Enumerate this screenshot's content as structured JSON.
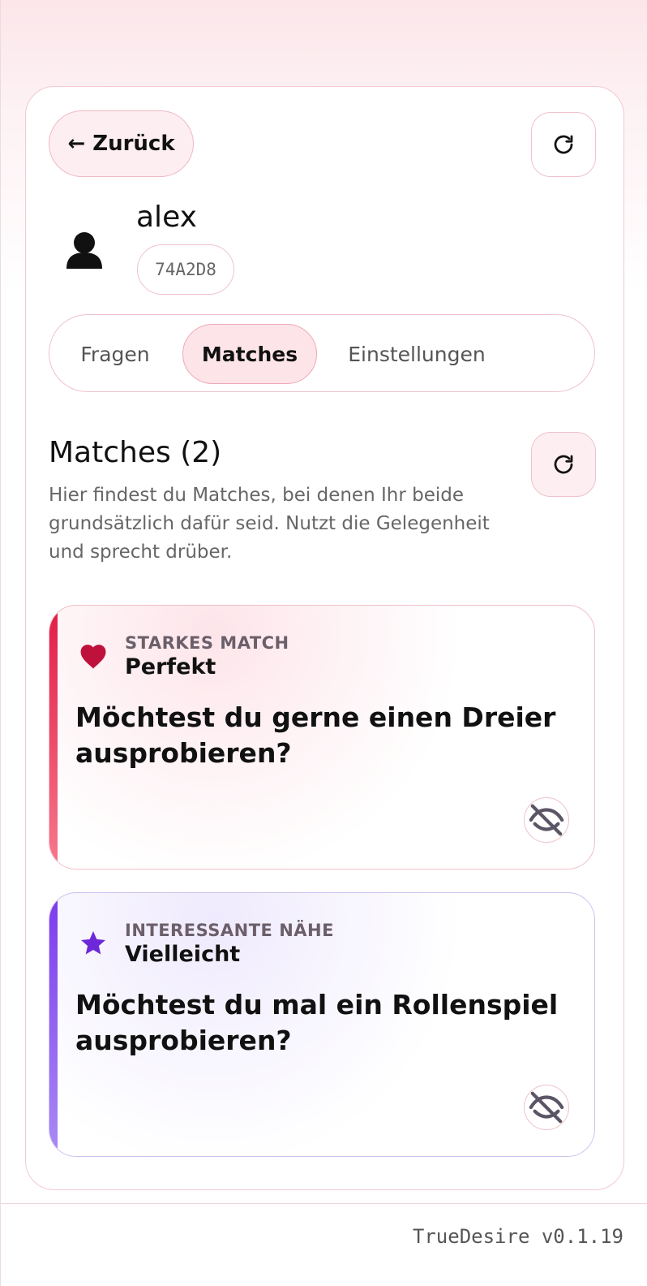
{
  "header": {
    "back_label": "← Zurück",
    "refresh_icon": "refresh-icon"
  },
  "profile": {
    "avatar_icon": "user-icon",
    "name": "alex",
    "code": "74A2D8"
  },
  "tabs": [
    {
      "label": "Fragen",
      "active": false
    },
    {
      "label": "Matches",
      "active": true
    },
    {
      "label": "Einstellungen",
      "active": false
    }
  ],
  "section": {
    "title": "Matches (2)",
    "description": "Hier findest du Matches, bei denen Ihr beide grundsätzlich dafür seid. Nutzt die Gelegenheit und sprecht drüber.",
    "refresh_icon": "refresh-icon"
  },
  "matches": [
    {
      "kind": "STARKES MATCH",
      "level": "Perfekt",
      "question": "Möchtest du gerne einen Dreier ausprobieren?",
      "icon": "heart-icon",
      "accent_color": "#e11d48",
      "hide_icon": "eye-off-icon"
    },
    {
      "kind": "INTERESSANTE NÄHE",
      "level": "Vielleicht",
      "question": "Möchtest du mal ein Rollenspiel ausprobieren?",
      "icon": "star-icon",
      "accent_color": "#7c3aed",
      "hide_icon": "eye-off-icon"
    }
  ],
  "footer": {
    "version": "TrueDesire v0.1.19"
  }
}
